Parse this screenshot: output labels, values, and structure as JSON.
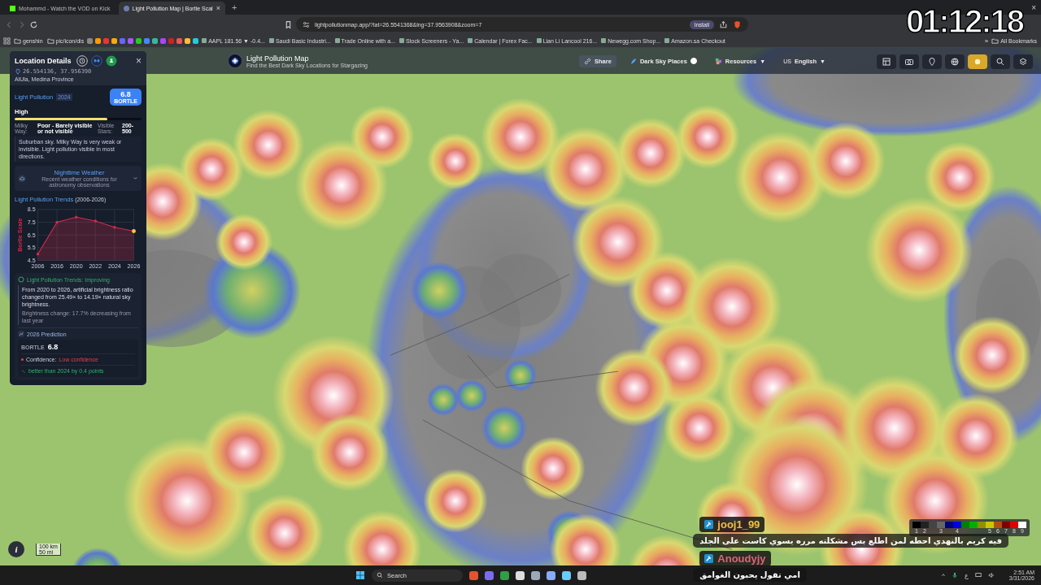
{
  "browser": {
    "tabs": [
      {
        "title": "Mohammd - Watch the VOD on Kick",
        "selected": false,
        "kind": "kick"
      },
      {
        "title": "Light Pollution Map | Bortle Scal",
        "selected": true,
        "kind": "globe"
      }
    ],
    "tab_close": "×",
    "new_tab": "+",
    "address": "lightpollutionmap.app/?lat=26.5541368&lng=37.9563908&zoom=7",
    "install": "Install",
    "bookmarks": [
      {
        "label": "genshin",
        "kind": "folder"
      },
      {
        "label": "pic/icon/dis",
        "kind": "folder"
      },
      {
        "label": "AAPL 181.56 ▼ -0.4...",
        "kind": "site"
      },
      {
        "label": "Saudi Basic Industri...",
        "kind": "site"
      },
      {
        "label": "Trade Online with a...",
        "kind": "site"
      },
      {
        "label": "Stock Screeners - Ya...",
        "kind": "site"
      },
      {
        "label": "Calendar | Forex Fac...",
        "kind": "site"
      },
      {
        "label": "Lian Li Lancool 216...",
        "kind": "site"
      },
      {
        "label": "Newegg.com Shop...",
        "kind": "site"
      },
      {
        "label": "Amazon.sa Checkout",
        "kind": "site"
      }
    ],
    "more_bookmarks": "»",
    "all_bookmarks": "All Bookmarks",
    "window_close": "×"
  },
  "overlay_timer": "01:12:18",
  "site": {
    "title": "Light Pollution Map",
    "subtitle": "Find the Best Dark Sky Locations for Stargazing",
    "nav": [
      {
        "kind": "button",
        "label": "Share"
      },
      {
        "kind": "toggle",
        "label": "Dark Sky Places",
        "on": true
      },
      {
        "kind": "dropdown",
        "label": "Resources",
        "caret": "▼"
      },
      {
        "kind": "dropdown",
        "prefix": "US",
        "label": "English",
        "caret": "▼"
      }
    ]
  },
  "panel": {
    "title": "Location Details",
    "close": "×",
    "coords": "26.554136, 37.956390",
    "place": "AlUla, Medina Province",
    "pollution": {
      "label": "Light Pollution",
      "year": "2024",
      "bortle": "6.8",
      "bortle_label": "BORTLE",
      "level_name": "High",
      "level": 0.73
    },
    "milky_way_label": "Milky Way:",
    "milky_way": "Poor - Barely visible or not visible",
    "stars_label": "Visible Stars:",
    "stars": "200-500",
    "description": "Suburban sky. Milky Way is very weak or invisible. Light pollution visible in most directions.",
    "weather": {
      "title": "Nighttime Weather",
      "subtitle": "Recent weather conditions for astronomy observations",
      "expanded": false
    },
    "trends": {
      "title": "Light Pollution Trends",
      "range": "(2006-2026)",
      "chart_data": {
        "type": "area",
        "ylabel": "Bortle Scale",
        "categories": [
          "2006",
          "2016",
          "2020",
          "2022",
          "2024",
          "2026"
        ],
        "series": [
          {
            "color": "#d42a4a",
            "values": [
              5.0,
              7.5,
              7.9,
              7.6,
              7.1,
              6.8
            ]
          }
        ],
        "ylim": [
          4.5,
          8.5
        ],
        "yticks": [
          4.5,
          5.5,
          6.5,
          7.5,
          8.5
        ],
        "grid": true
      }
    },
    "status": {
      "title": "Light Pollution Trends: Improving",
      "text": "From 2020 to 2026, artificial brightness ratio changed from 25.49× to 14.19× natural sky brightness.",
      "change": "Brightness change: 17.7% decreasing from last year"
    },
    "prediction": {
      "title": "2026 Prediction",
      "bortle_label": "BORTLE",
      "value": "6.8",
      "confidence_label": "Confidence:",
      "confidence": "Low confidence",
      "comparison": "better than 2024 by 0.4 points"
    }
  },
  "map_controls": [
    {
      "kind": "table",
      "active": false
    },
    {
      "kind": "camera",
      "active": false
    },
    {
      "kind": "pin",
      "active": false
    },
    {
      "kind": "globe",
      "active": false
    },
    {
      "kind": "sun",
      "active": true
    },
    {
      "kind": "search",
      "active": false
    },
    {
      "kind": "layers",
      "active": false
    }
  ],
  "info_button": "i",
  "scale": {
    "metric": "100 km",
    "imperial": "50 mi"
  },
  "legend": [
    {
      "color": "#000000",
      "label": "1"
    },
    {
      "color": "#222222",
      "label": "2"
    },
    {
      "color": "#444444"
    },
    {
      "color": "#666666",
      "label": "3"
    },
    {
      "color": "#00007a"
    },
    {
      "color": "#0000e0",
      "label": "4"
    },
    {
      "color": "#008000"
    },
    {
      "color": "#00b000"
    },
    {
      "color": "#909000"
    },
    {
      "color": "#c8c800",
      "label": "5"
    },
    {
      "color": "#b05010",
      "label": "6"
    },
    {
      "color": "#800000",
      "label": "7"
    },
    {
      "color": "#e00000",
      "label": "8"
    },
    {
      "color": "#ffffff",
      "label": "9"
    }
  ],
  "chat": [
    {
      "user": "jooj1_99",
      "color": "#f0c040",
      "message": "فيه كريم بالنهدي احطه لمن اطلع بس مشكلته مرره يسوي كاست على الجلد"
    },
    {
      "user": "Anoudyjy",
      "color": "#e0607a",
      "message": "امي تقول يحبون الغوامق"
    }
  ],
  "taskbar": {
    "search": "Search",
    "tray_caret": "^",
    "language": "ع",
    "time": "2:51 AM",
    "date": "3/31/2026"
  }
}
